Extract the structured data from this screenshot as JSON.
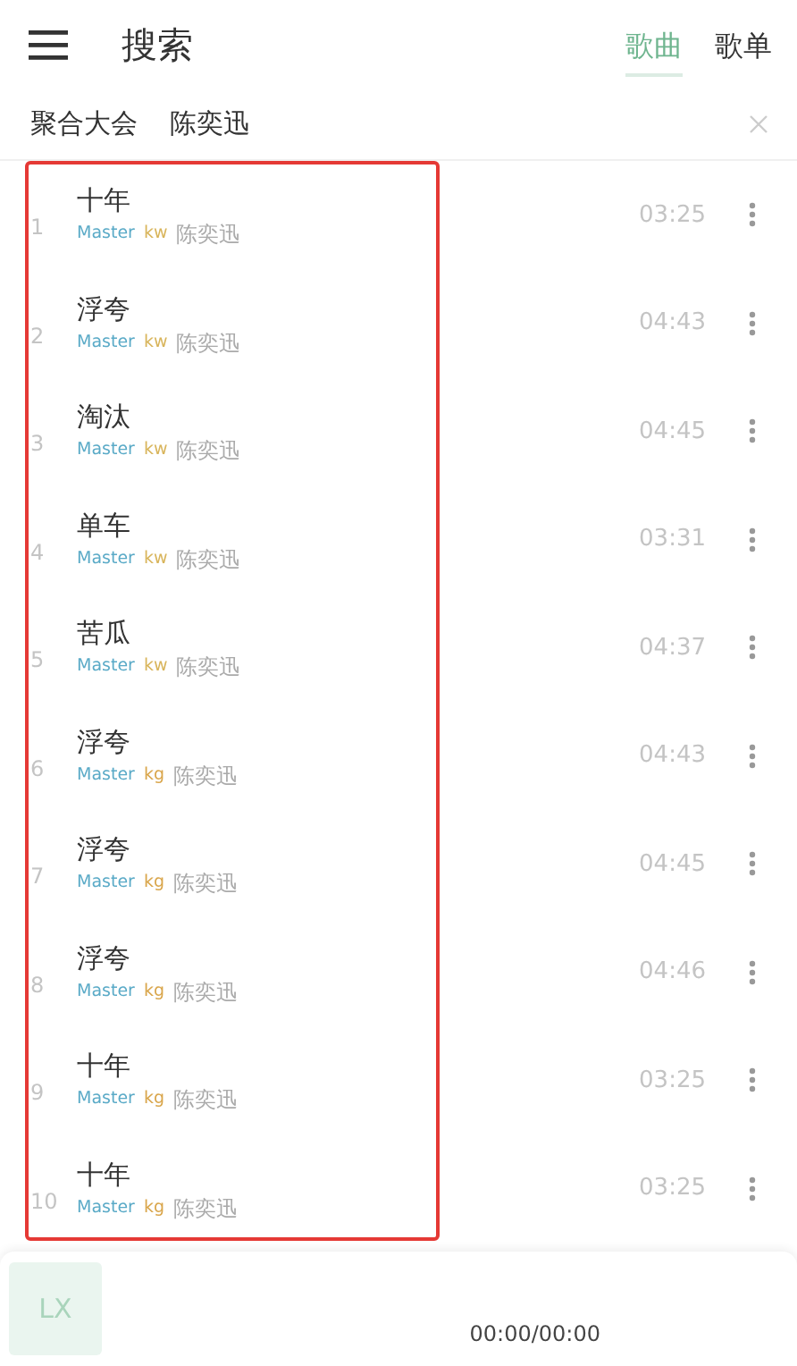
{
  "header": {
    "title": "搜索",
    "tabs": [
      {
        "label": "歌曲",
        "selected": true
      },
      {
        "label": "歌单",
        "selected": false
      }
    ]
  },
  "search": {
    "source": "聚合大会",
    "value": "陈奕迅"
  },
  "songs": [
    {
      "index": "1",
      "title": "十年",
      "quality": "Master",
      "source": "kw",
      "artist": "陈奕迅",
      "duration": "03:25"
    },
    {
      "index": "2",
      "title": "浮夸",
      "quality": "Master",
      "source": "kw",
      "artist": "陈奕迅",
      "duration": "04:43"
    },
    {
      "index": "3",
      "title": "淘汰",
      "quality": "Master",
      "source": "kw",
      "artist": "陈奕迅",
      "duration": "04:45"
    },
    {
      "index": "4",
      "title": "单车",
      "quality": "Master",
      "source": "kw",
      "artist": "陈奕迅",
      "duration": "03:31"
    },
    {
      "index": "5",
      "title": "苦瓜",
      "quality": "Master",
      "source": "kw",
      "artist": "陈奕迅",
      "duration": "04:37"
    },
    {
      "index": "6",
      "title": "浮夸",
      "quality": "Master",
      "source": "kg",
      "artist": "陈奕迅",
      "duration": "04:43"
    },
    {
      "index": "7",
      "title": "浮夸",
      "quality": "Master",
      "source": "kg",
      "artist": "陈奕迅",
      "duration": "04:45"
    },
    {
      "index": "8",
      "title": "浮夸",
      "quality": "Master",
      "source": "kg",
      "artist": "陈奕迅",
      "duration": "04:46"
    },
    {
      "index": "9",
      "title": "十年",
      "quality": "Master",
      "source": "kg",
      "artist": "陈奕迅",
      "duration": "03:25"
    },
    {
      "index": "10",
      "title": "十年",
      "quality": "Master",
      "source": "kg",
      "artist": "陈奕迅",
      "duration": "03:25"
    }
  ],
  "player": {
    "logo": "LX",
    "time": "00:00/00:00"
  }
}
